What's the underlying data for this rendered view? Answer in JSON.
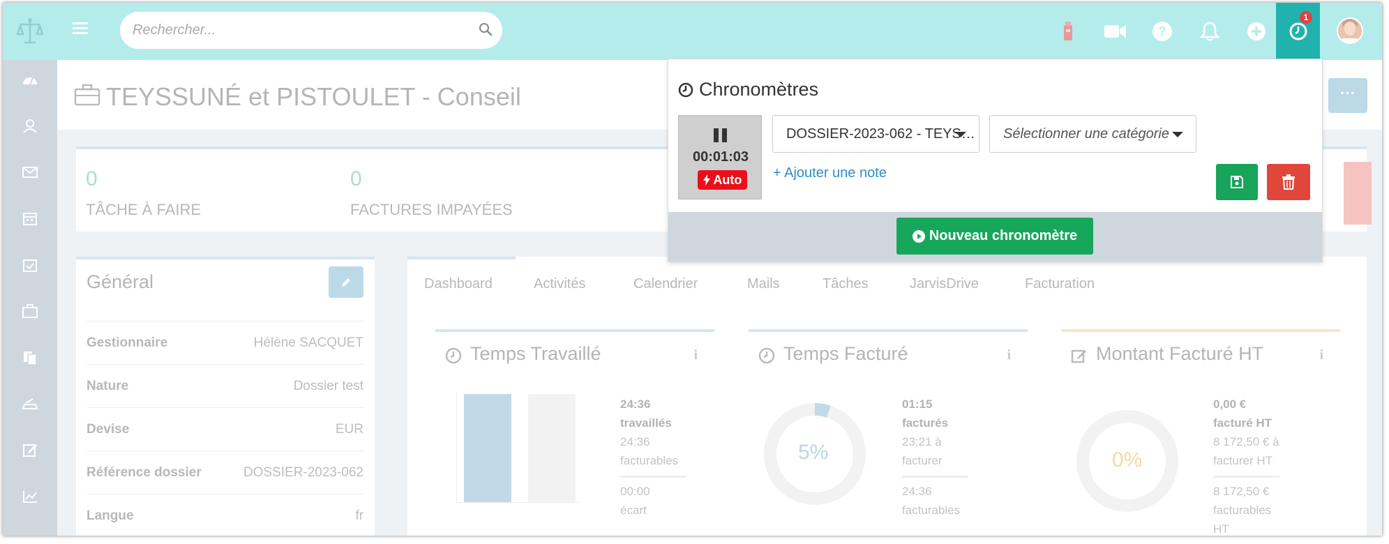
{
  "topbar": {
    "search_placeholder": "Rechercher...",
    "chrono_badge": "1",
    "icons": [
      "flask-icon",
      "video-icon",
      "help-icon",
      "bell-icon",
      "plus-icon",
      "clock-icon"
    ]
  },
  "sidebar": {
    "items": [
      "dashboard-icon",
      "contacts-icon",
      "mail-icon",
      "calendar-icon",
      "tasks-icon",
      "briefcase-icon",
      "documents-icon",
      "scanner-icon",
      "edit-icon",
      "chart-icon"
    ]
  },
  "page": {
    "title": "TEYSSUNÉ et PISTOULET - Conseil",
    "more": "···"
  },
  "stats": [
    {
      "value": "0",
      "label": "TÂCHE À FAIRE"
    },
    {
      "value": "0",
      "label": "FACTURES IMPAYÉES"
    }
  ],
  "general": {
    "title": "Général",
    "rows": [
      {
        "key": "Gestionnaire",
        "value": "Hélène SACQUET"
      },
      {
        "key": "Nature",
        "value": "Dossier test"
      },
      {
        "key": "Devise",
        "value": "EUR"
      },
      {
        "key": "Référence dossier",
        "value": "DOSSIER-2023-062"
      },
      {
        "key": "Langue",
        "value": "fr"
      }
    ]
  },
  "tabs": [
    "Dashboard",
    "Activités",
    "Calendrier",
    "Mails",
    "Tâches",
    "JarvisDrive",
    "Facturation"
  ],
  "cards": {
    "worked": {
      "title": "Temps Travaillé",
      "info": "i",
      "line1": "24:36",
      "line2": "travaillés",
      "line3": "24:36",
      "line4": "facturables",
      "line5": "00:00",
      "line6": "écart"
    },
    "billed": {
      "title": "Temps Facturé",
      "info": "i",
      "pct": "5%",
      "pct_value": 5,
      "line1": "01:15",
      "line2": "facturés",
      "line3": "23:21 à",
      "line4": "facturer",
      "line5": "24:36",
      "line6": "facturables"
    },
    "amount": {
      "title": "Montant Facturé HT",
      "info": "i",
      "pct": "0%",
      "pct_value": 0,
      "line1": "0,00 €",
      "line2": "facturé HT",
      "line3": "8 172,50 € à",
      "line4": "facturer HT",
      "line5": "8 172,50 €",
      "line6": "facturables",
      "line7": "HT"
    }
  },
  "popover": {
    "title": "Chronomètres",
    "time": "00:01:03",
    "auto": "Auto",
    "dossier": "DOSSIER-2023-062 - TEYS…",
    "category_placeholder": "Sélectionner une catégorie",
    "add_note": "+ Ajouter une note",
    "new_button": "Nouveau chronomètre"
  },
  "colors": {
    "topbar": "#b4ecec",
    "accent": "#21b2ad",
    "success": "#17a75b",
    "danger": "#e0473a",
    "auto_badge": "#e8111b",
    "link": "#2a8ec8"
  }
}
